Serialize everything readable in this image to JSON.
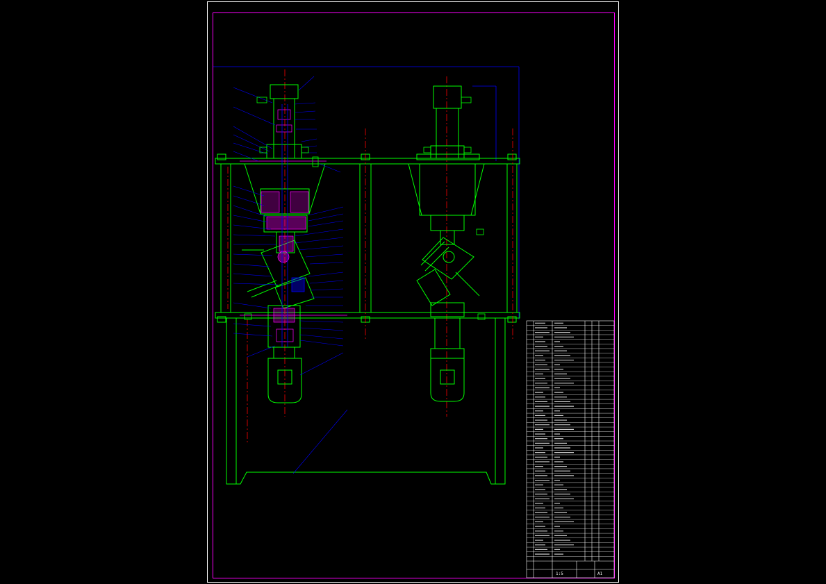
{
  "drawing": {
    "kind": "CAD assembly drawing",
    "background": "#000000",
    "colors": {
      "frame_outer": "#ffffff",
      "frame_inner": "#ff00ff",
      "outline": "#00ff00",
      "center_line": "#ff0000",
      "leader": "#0000ff",
      "section_hatch": "#ff00ff",
      "bom_lines": "#ffffff"
    }
  },
  "title_block": {
    "labels": [
      "1:5",
      "A1"
    ]
  },
  "bom": {
    "row_count": 52
  }
}
